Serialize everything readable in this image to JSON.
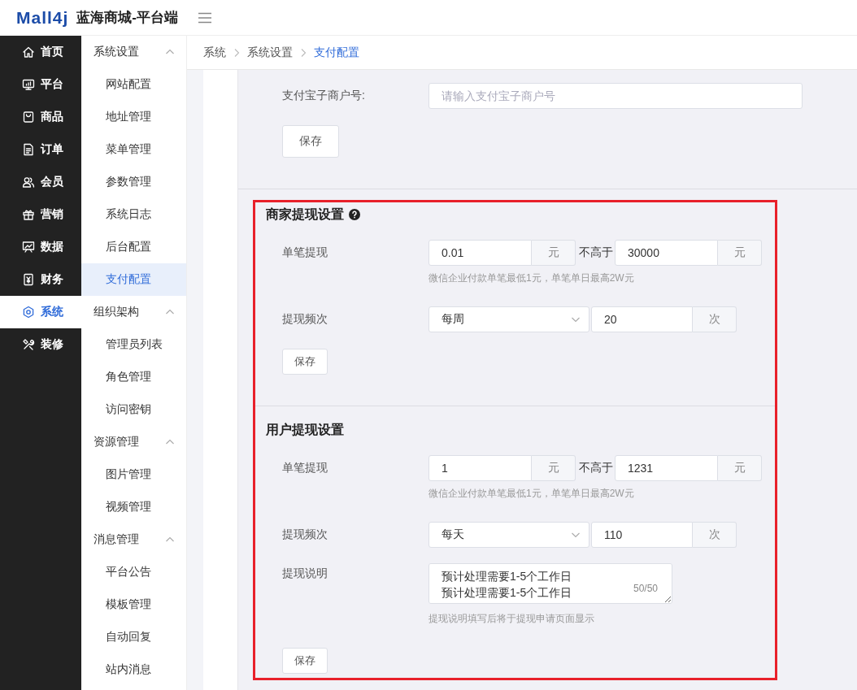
{
  "header": {
    "logo": "Mall4j",
    "title": "蓝海商城-平台端"
  },
  "nav": [
    {
      "label": "首页",
      "selected": false
    },
    {
      "label": "平台",
      "selected": false
    },
    {
      "label": "商品",
      "selected": false
    },
    {
      "label": "订单",
      "selected": false
    },
    {
      "label": "会员",
      "selected": false
    },
    {
      "label": "营销",
      "selected": false
    },
    {
      "label": "数据",
      "selected": false
    },
    {
      "label": "财务",
      "selected": false
    },
    {
      "label": "系统",
      "selected": true
    },
    {
      "label": "装修",
      "selected": false
    }
  ],
  "submenu": [
    {
      "label": "系统设置",
      "expanded": true,
      "items": [
        {
          "label": "网站配置",
          "selected": false
        },
        {
          "label": "地址管理",
          "selected": false
        },
        {
          "label": "菜单管理",
          "selected": false
        },
        {
          "label": "参数管理",
          "selected": false
        },
        {
          "label": "系统日志",
          "selected": false
        },
        {
          "label": "后台配置",
          "selected": false
        },
        {
          "label": "支付配置",
          "selected": true
        }
      ]
    },
    {
      "label": "组织架构",
      "expanded": true,
      "items": [
        {
          "label": "管理员列表",
          "selected": false
        },
        {
          "label": "角色管理",
          "selected": false
        },
        {
          "label": "访问密钥",
          "selected": false
        }
      ]
    },
    {
      "label": "资源管理",
      "expanded": true,
      "items": [
        {
          "label": "图片管理",
          "selected": false
        },
        {
          "label": "视频管理",
          "selected": false
        }
      ]
    },
    {
      "label": "消息管理",
      "expanded": true,
      "items": [
        {
          "label": "平台公告",
          "selected": false
        },
        {
          "label": "模板管理",
          "selected": false
        },
        {
          "label": "自动回复",
          "selected": false
        },
        {
          "label": "站内消息",
          "selected": false
        }
      ]
    }
  ],
  "breadcrumb": [
    "系统",
    "系统设置",
    "支付配置"
  ],
  "alipay": {
    "label": "支付宝子商户号:",
    "placeholder": "请输入支付宝子商户号",
    "save": "保存"
  },
  "merchant_withdraw": {
    "title": "商家提现设置",
    "single": {
      "label": "单笔提现",
      "min": "0.01",
      "min_unit": "元",
      "between": "不高于",
      "max": "30000",
      "max_unit": "元"
    },
    "single_hint": "微信企业付款单笔最低1元，单笔单日最高2W元",
    "frequency": {
      "label": "提现频次",
      "period": "每周",
      "count": "20",
      "unit": "次"
    },
    "save": "保存"
  },
  "user_withdraw": {
    "title": "用户提现设置",
    "single": {
      "label": "单笔提现",
      "min": "1",
      "min_unit": "元",
      "between": "不高于",
      "max": "1231",
      "max_unit": "元"
    },
    "single_hint": "微信企业付款单笔最低1元，单笔单日最高2W元",
    "frequency": {
      "label": "提现频次",
      "period": "每天",
      "count": "110",
      "unit": "次"
    },
    "note": {
      "label": "提现说明",
      "lines": [
        "预计处理需要1-5个工作日",
        "预计处理需要1-5个工作日"
      ],
      "counter": "50/50"
    },
    "note_hint": "提现说明填写后将于提现申请页面显示",
    "save": "保存"
  }
}
